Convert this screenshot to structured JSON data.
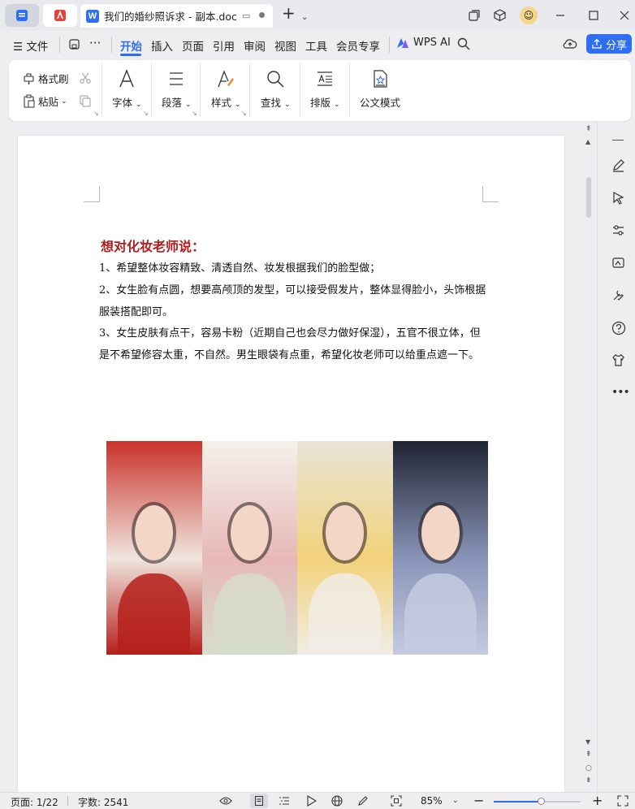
{
  "titlebar": {
    "tab_title": "我们的婚纱照诉求 - 副本.doc",
    "icons": [
      "home-icon",
      "pdf-icon",
      "new-tab-icon",
      "chevron-down-icon",
      "restore-icon",
      "cube-icon",
      "avatar",
      "minimize-icon",
      "maximize-icon",
      "close-icon"
    ]
  },
  "menu": {
    "file_label": "文件",
    "items": [
      "开始",
      "插入",
      "页面",
      "引用",
      "审阅",
      "视图",
      "工具",
      "会员专享"
    ],
    "active": "开始",
    "wps_ai": "WPS AI",
    "share": "分享"
  },
  "ribbon": {
    "format_painter": "格式刷",
    "paste": "粘贴",
    "font": "字体",
    "paragraph": "段落",
    "styles": "样式",
    "find": "查找",
    "layout": "排版",
    "official": "公文模式"
  },
  "document": {
    "heading": "想对化妆老师说：",
    "paragraphs": [
      "1、希望整体妆容精致、清透自然、妆发根据我们的脸型做；",
      "2、女生脸有点圆，想要高颅顶的发型，可以接受假发片，整体显得脸小，头饰根据服装搭配即可。",
      "3、女生皮肤有点干，容易卡粉（近期自己也会尽力做好保湿），五官不很立体，但是不希望修容太重，不自然。男生眼袋有点重，希望化妆老师可以给重点遮一下。"
    ],
    "photo_colors": [
      {
        "top": "#c9322a",
        "mid": "#f0e6df",
        "bottom": "#b5201c"
      },
      {
        "top": "#f4f1ea",
        "mid": "#e8b8b8",
        "bottom": "#d7dccd"
      },
      {
        "top": "#e9e4d8",
        "mid": "#f2d27a",
        "bottom": "#f1ece6"
      },
      {
        "top": "#202433",
        "mid": "#8a94b8",
        "bottom": "#c4cbe0"
      }
    ]
  },
  "status": {
    "page": "页面: 1/22",
    "words": "字数: 2541",
    "zoom": "85%",
    "zoom_level": 0.55
  },
  "colors": {
    "accent": "#2f6ef0",
    "heading_red": "#b11d1d"
  }
}
